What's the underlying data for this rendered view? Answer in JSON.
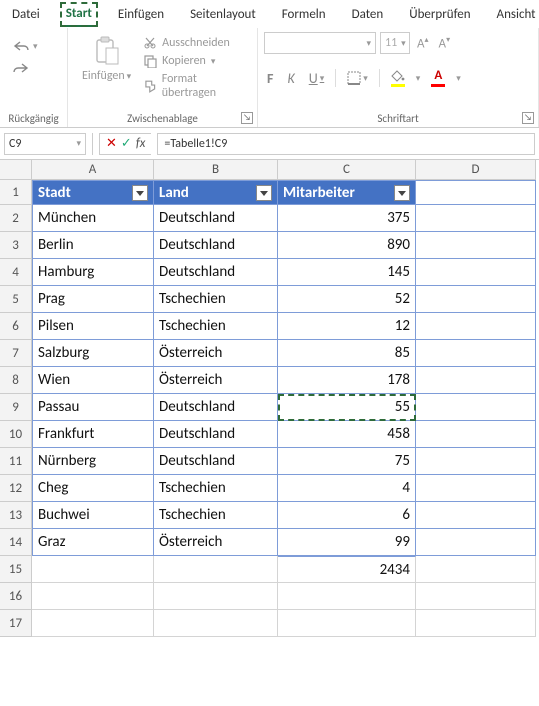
{
  "menu": {
    "tabs": [
      "Datei",
      "Start",
      "Einfügen",
      "Seitenlayout",
      "Formeln",
      "Daten",
      "Überprüfen",
      "Ansicht"
    ],
    "active_index": 1
  },
  "ribbon": {
    "undo_group_label": "Rückgängig",
    "clipboard_group_label": "Zwischenablage",
    "font_group_label": "Schriftart",
    "paste_label": "Einfügen",
    "cut_label": "Ausschneiden",
    "copy_label": "Kopieren",
    "format_painter_label": "Format übertragen",
    "font_name_placeholder": " ",
    "font_size_placeholder": "11",
    "bold_label": "F",
    "italic_label": "K",
    "underline_label": "U"
  },
  "formula_bar": {
    "name_box": "C9",
    "formula": "=Tabelle1!C9",
    "fx_label": "fx"
  },
  "columns": [
    "A",
    "B",
    "C",
    "D"
  ],
  "table": {
    "headers": [
      "Stadt",
      "Land",
      "Mitarbeiter"
    ],
    "rows": [
      {
        "stadt": "München",
        "land": "Deutschland",
        "mitarbeiter": 375
      },
      {
        "stadt": "Berlin",
        "land": "Deutschland",
        "mitarbeiter": 890
      },
      {
        "stadt": "Hamburg",
        "land": "Deutschland",
        "mitarbeiter": 145
      },
      {
        "stadt": "Prag",
        "land": "Tschechien",
        "mitarbeiter": 52
      },
      {
        "stadt": "Pilsen",
        "land": "Tschechien",
        "mitarbeiter": 12
      },
      {
        "stadt": "Salzburg",
        "land": "Österreich",
        "mitarbeiter": 85
      },
      {
        "stadt": "Wien",
        "land": "Österreich",
        "mitarbeiter": 178
      },
      {
        "stadt": "Passau",
        "land": "Deutschland",
        "mitarbeiter": 55
      },
      {
        "stadt": "Frankfurt",
        "land": "Deutschland",
        "mitarbeiter": 458
      },
      {
        "stadt": "Nürnberg",
        "land": "Deutschland",
        "mitarbeiter": 75
      },
      {
        "stadt": "Cheg",
        "land": "Tschechien",
        "mitarbeiter": 4
      },
      {
        "stadt": "Buchwei",
        "land": "Tschechien",
        "mitarbeiter": 6
      },
      {
        "stadt": "Graz",
        "land": "Österreich",
        "mitarbeiter": 99
      }
    ],
    "sum": 2434
  },
  "active_cell": "C9"
}
